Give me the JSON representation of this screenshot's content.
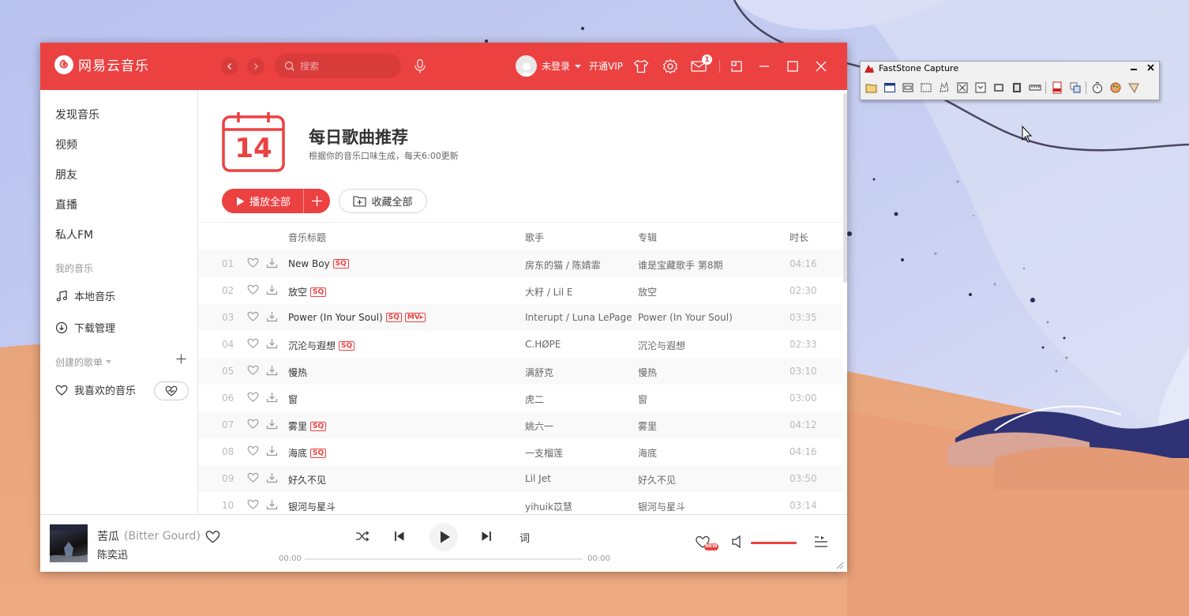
{
  "app": {
    "logo_text": "网易云音乐",
    "search_placeholder": "搜索",
    "user": {
      "login_label": "未登录",
      "vip_label": "开通VIP"
    },
    "mail_badge": "1"
  },
  "sidebar": {
    "items": [
      {
        "label": "发现音乐"
      },
      {
        "label": "视频"
      },
      {
        "label": "朋友"
      },
      {
        "label": "直播"
      },
      {
        "label": "私人FM"
      }
    ],
    "my_music_title": "我的音乐",
    "my_music_items": [
      {
        "label": "本地音乐",
        "icon": "music-note-icon"
      },
      {
        "label": "下载管理",
        "icon": "download-icon"
      }
    ],
    "created_playlists_title": "创建的歌单",
    "liked_playlist_label": "我喜欢的音乐"
  },
  "daily": {
    "calendar_day": "14",
    "title": "每日歌曲推荐",
    "subtitle": "根据你的音乐口味生成，每天6:00更新",
    "play_all_label": "播放全部",
    "collect_all_label": "收藏全部"
  },
  "table": {
    "headers": {
      "title": "音乐标题",
      "artist": "歌手",
      "album": "专辑",
      "duration": "时长"
    },
    "rows": [
      {
        "num": "01",
        "title": "New Boy",
        "tags": [
          "SQ"
        ],
        "artist": "房东的猫 / 陈婧霏",
        "album": "谁是宝藏歌手 第8期",
        "duration": "04:16"
      },
      {
        "num": "02",
        "title": "放空",
        "tags": [
          "SQ"
        ],
        "artist": "大籽 / Lil E",
        "album": "放空",
        "duration": "02:30"
      },
      {
        "num": "03",
        "title": "Power (In Your Soul)",
        "tags": [
          "SQ",
          "MV▸"
        ],
        "artist": "Interupt / Luna LePage",
        "album": "Power (In Your Soul)",
        "duration": "03:35"
      },
      {
        "num": "04",
        "title": "沉沦与遐想",
        "tags": [
          "SQ"
        ],
        "artist": "C.HØPE",
        "album": "沉沦与遐想",
        "duration": "02:33"
      },
      {
        "num": "05",
        "title": "慢热",
        "tags": [],
        "artist": "满舒克",
        "album": "慢热",
        "duration": "03:10"
      },
      {
        "num": "06",
        "title": "窗",
        "tags": [],
        "artist": "虎二",
        "album": "窗",
        "duration": "03:00"
      },
      {
        "num": "07",
        "title": "雾里",
        "tags": [
          "SQ"
        ],
        "artist": "姚六一",
        "album": "雾里",
        "duration": "04:12"
      },
      {
        "num": "08",
        "title": "海底",
        "tags": [
          "SQ"
        ],
        "artist": "一支榴莲",
        "album": "海底",
        "duration": "04:16"
      },
      {
        "num": "09",
        "title": "好久不见",
        "tags": [],
        "artist": "Lil Jet",
        "album": "好久不见",
        "duration": "03:50"
      },
      {
        "num": "10",
        "title": "银河与星斗",
        "tags": [],
        "artist": "yihuik苡慧",
        "album": "银河与星斗",
        "duration": "03:14"
      }
    ]
  },
  "player": {
    "song_title": "苦瓜",
    "song_title_en": "(Bitter Gourd)",
    "artist": "陈奕迅",
    "lyrics_label": "词",
    "current_time": "00:00",
    "total_time": "00:00",
    "new_badge": "NEW",
    "progress": 0,
    "volume": 1.0
  },
  "faststone": {
    "title": "FastStone Capture",
    "tools": [
      "open-icon",
      "window-capture-icon",
      "object-capture-icon",
      "rect-capture-icon",
      "freehand-capture-icon",
      "fullscreen-capture-icon",
      "scroll-capture-icon",
      "fixed-region-icon",
      "video-capture-icon",
      "ruler-icon",
      "pdf-icon",
      "convert-icon",
      "timer-icon",
      "output-icon",
      "settings-icon"
    ]
  },
  "colors": {
    "accent": "#ec4141",
    "sq_tag": "#ec4141"
  }
}
